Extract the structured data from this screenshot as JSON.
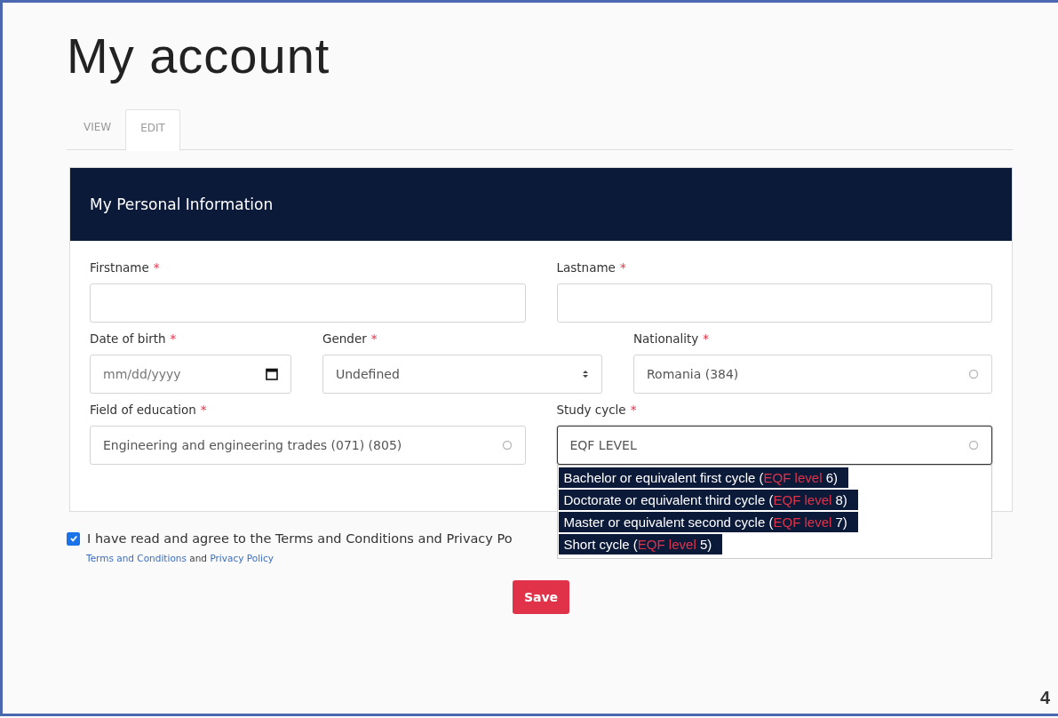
{
  "page": {
    "title": "My account",
    "page_number": "4"
  },
  "tabs": [
    {
      "label": "VIEW",
      "selected": false
    },
    {
      "label": "EDIT",
      "selected": true
    }
  ],
  "card": {
    "title": "My Personal Information",
    "rows": [
      [
        {
          "label": "Firstname",
          "mark": "*",
          "kind": "text"
        },
        {
          "label": "Lastname",
          "mark": "*",
          "kind": "text"
        }
      ],
      [
        {
          "label": "Date of birth",
          "mark": "*",
          "kind": "date",
          "placeholder": "mm/dd/yyyy"
        },
        {
          "label": "Gender",
          "mark": "*",
          "kind": "select",
          "value": "Undefined"
        },
        {
          "label": "Nationality",
          "mark": "*",
          "kind": "autocomplete",
          "value": "Romania (384)"
        }
      ],
      [
        {
          "label": "Field of education",
          "mark": "*",
          "kind": "autocomplete",
          "value": "Engineering and engineering trades (071) (805)"
        },
        {
          "label": "Study cycle",
          "mark": "*",
          "kind": "autocomplete",
          "value": "EQF LEVEL",
          "focused": true,
          "options": [
            {
              "before": "Bachelor or equivalent first cycle (",
              "match": "EQF level",
              "after": " 6)"
            },
            {
              "before": "Doctorate or equivalent third cycle (",
              "match": "EQF level",
              "after": " 8)"
            },
            {
              "before": "Master or equivalent second cycle (",
              "match": "EQF level",
              "after": " 7)"
            },
            {
              "before": "Short cycle (",
              "match": "EQF level",
              "after": " 5)"
            }
          ]
        }
      ]
    ]
  },
  "agreement": {
    "checked": true,
    "text": "I have read and agree to the Terms and Conditions and Privacy Po",
    "links": [
      {
        "kind": "link",
        "text": "Terms and Conditions"
      },
      {
        "kind": "plain",
        "text": "and"
      },
      {
        "kind": "link",
        "text": "Privacy Policy"
      }
    ]
  },
  "save_button": "Save"
}
